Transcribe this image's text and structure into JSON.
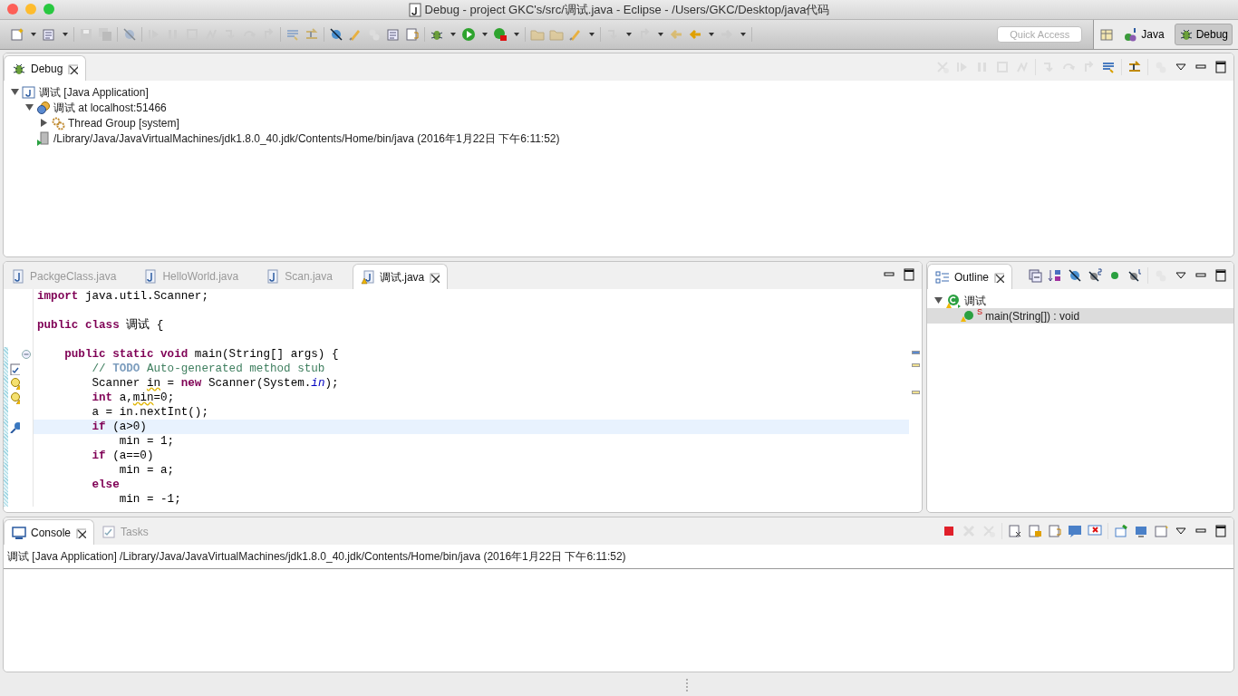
{
  "window": {
    "title": "Debug - project GKC's/src/调试.java - Eclipse - /Users/GKC/Desktop/java代码"
  },
  "toolbar": {
    "quick_access": {
      "placeholder": "Quick Access"
    },
    "perspectives": [
      {
        "label": "Java",
        "selected": false
      },
      {
        "label": "Debug",
        "selected": true
      }
    ]
  },
  "debug_view": {
    "tab": "Debug",
    "tree": [
      {
        "label": "调试 [Java Application]",
        "kind": "app",
        "expanded": true,
        "children": [
          {
            "label": "调试 at localhost:51466",
            "kind": "vm",
            "expanded": true,
            "children": [
              {
                "label": "Thread Group [system]",
                "kind": "group",
                "expanded": false
              }
            ]
          },
          {
            "label": "/Library/Java/JavaVirtualMachines/jdk1.8.0_40.jdk/Contents/Home/bin/java (2016年1月22日 下午6:11:52)",
            "kind": "process"
          }
        ]
      }
    ]
  },
  "editor": {
    "tabs": [
      {
        "label": "PackgeClass.java",
        "selected": false
      },
      {
        "label": "HelloWorld.java",
        "selected": false
      },
      {
        "label": "Scan.java",
        "selected": false
      },
      {
        "label": "调试.java",
        "selected": true
      }
    ],
    "lines": [
      {
        "kind": "code",
        "in_range": false,
        "tokens": [
          {
            "text": "import",
            "kind": "keyword"
          },
          {
            "text": " java.util.Scanner;",
            "kind": "plain"
          }
        ]
      },
      {
        "kind": "blank",
        "in_range": false
      },
      {
        "kind": "code",
        "in_range": false,
        "tokens": [
          {
            "text": "public class",
            "kind": "keyword"
          },
          {
            "text": " 调试 {",
            "kind": "plain"
          }
        ]
      },
      {
        "kind": "blank",
        "in_range": false
      },
      {
        "kind": "code",
        "in_range": true,
        "marker": {
          "kind": "fold"
        },
        "tokens": [
          {
            "text": "    public static void",
            "kind": "keyword"
          },
          {
            "text": " main(String[] args) {",
            "kind": "plain"
          }
        ]
      },
      {
        "kind": "code",
        "in_range": true,
        "marker": {
          "kind": "task"
        },
        "tokens": [
          {
            "text": "        // ",
            "kind": "comment"
          },
          {
            "text": "TODO",
            "kind": "todo"
          },
          {
            "text": " Auto-generated method stub",
            "kind": "comment"
          }
        ]
      },
      {
        "kind": "code",
        "in_range": true,
        "marker": {
          "kind": "warning"
        },
        "tokens": [
          {
            "text": "        Scanner ",
            "kind": "plain"
          },
          {
            "text": "in",
            "kind": "warn"
          },
          {
            "text": " = ",
            "kind": "plain"
          },
          {
            "text": "new",
            "kind": "keyword"
          },
          {
            "text": " Scanner(System.",
            "kind": "plain"
          },
          {
            "text": "in",
            "kind": "field"
          },
          {
            "text": ");",
            "kind": "plain"
          }
        ]
      },
      {
        "kind": "code",
        "in_range": true,
        "marker": {
          "kind": "warning"
        },
        "tokens": [
          {
            "text": "        int",
            "kind": "keyword"
          },
          {
            "text": " a,",
            "kind": "plain"
          },
          {
            "text": "min",
            "kind": "warn"
          },
          {
            "text": "=0;",
            "kind": "plain"
          }
        ]
      },
      {
        "kind": "code",
        "in_range": true,
        "tokens": [
          {
            "text": "        a = in.nextInt();",
            "kind": "plain"
          }
        ]
      },
      {
        "kind": "code",
        "in_range": true,
        "marker": {
          "kind": "debug"
        },
        "highlighted": true,
        "tokens": [
          {
            "text": "        if",
            "kind": "keyword"
          },
          {
            "text": " (a>0)",
            "kind": "plain"
          }
        ]
      },
      {
        "kind": "code",
        "in_range": true,
        "tokens": [
          {
            "text": "            min = 1;",
            "kind": "plain"
          }
        ]
      },
      {
        "kind": "code",
        "in_range": true,
        "tokens": [
          {
            "text": "        if",
            "kind": "keyword"
          },
          {
            "text": " (a==0)",
            "kind": "plain"
          }
        ]
      },
      {
        "kind": "code",
        "in_range": true,
        "tokens": [
          {
            "text": "            min = a;",
            "kind": "plain"
          }
        ]
      },
      {
        "kind": "code",
        "in_range": true,
        "tokens": [
          {
            "text": "        else",
            "kind": "keyword"
          }
        ]
      },
      {
        "kind": "code",
        "in_range": true,
        "tokens": [
          {
            "text": "            min = -1;",
            "kind": "plain"
          }
        ]
      }
    ]
  },
  "outline": {
    "tab": "Outline",
    "tree": [
      {
        "label": "调试",
        "kind": "class",
        "expanded": true,
        "selected": false,
        "children": [
          {
            "label": "main(String[]) : void",
            "kind": "method",
            "selected": true,
            "static_mark": "S"
          }
        ]
      }
    ]
  },
  "console": {
    "tabs": [
      {
        "label": "Console",
        "selected": true
      },
      {
        "label": "Tasks",
        "selected": false
      }
    ],
    "header": "调试 [Java Application] /Library/Java/JavaVirtualMachines/jdk1.8.0_40.jdk/Contents/Home/bin/java (2016年1月22日 下午6:11:52)"
  }
}
